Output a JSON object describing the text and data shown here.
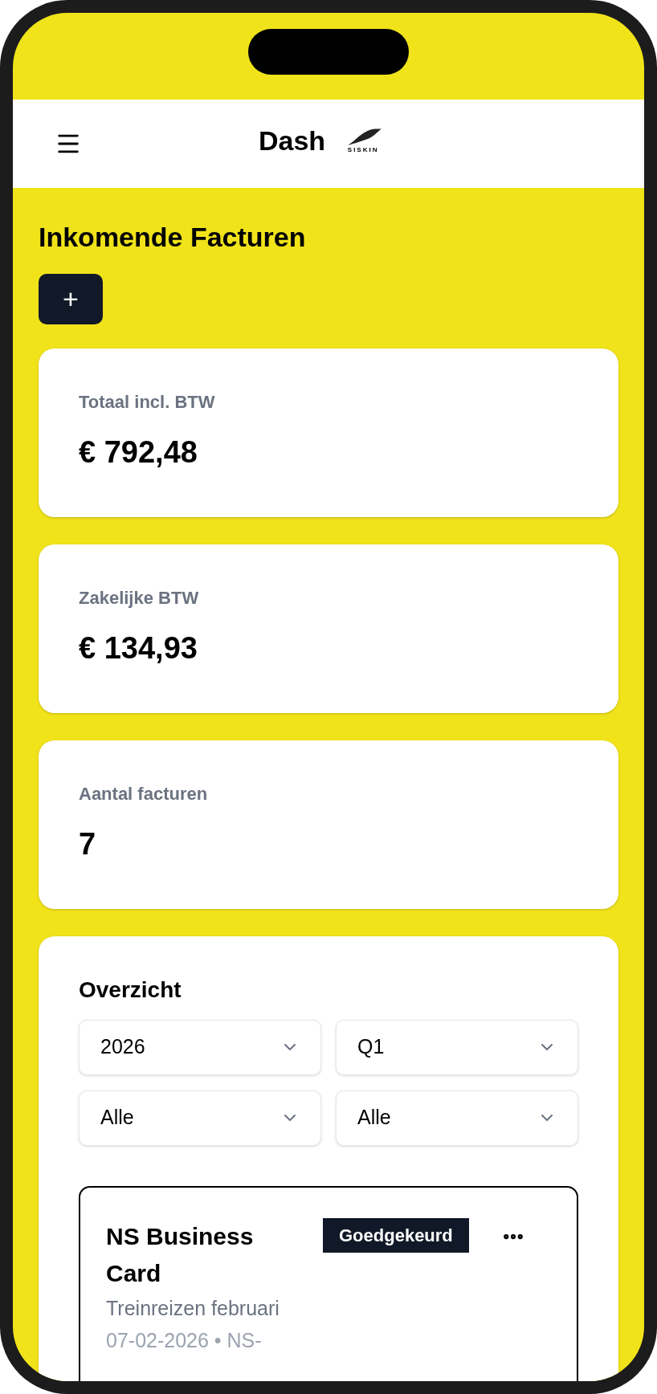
{
  "header": {
    "title": "Dash",
    "logo_text": "SISKIN"
  },
  "page_title": "Inkomende Facturen",
  "add_button": {
    "label": "+"
  },
  "stats": [
    {
      "label": "Totaal incl. BTW",
      "value": "€ 792,48"
    },
    {
      "label": "Zakelijke BTW",
      "value": "€ 134,93"
    },
    {
      "label": "Aantal facturen",
      "value": "7"
    }
  ],
  "overview": {
    "title": "Overzicht",
    "filters": [
      {
        "value": "2026"
      },
      {
        "value": "Q1"
      },
      {
        "value": "Alle"
      },
      {
        "value": "Alle"
      }
    ],
    "invoices": [
      {
        "name": "NS Business Card",
        "status": "Goedgekeurd",
        "description": "Treinreizen februari",
        "meta": "07-02-2026 • NS-"
      }
    ]
  }
}
